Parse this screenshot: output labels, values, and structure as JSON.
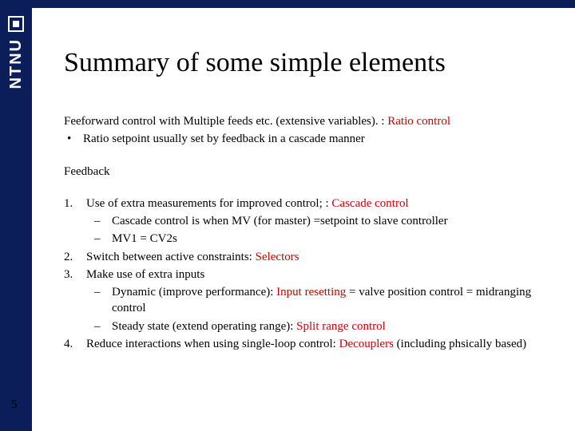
{
  "brand": {
    "name": "NTNU"
  },
  "slide": {
    "title": "Summary of some simple elements",
    "page_number": "5"
  },
  "feedforward": {
    "heading_pre": "Feeforward control with Multiple feeds etc. (extensive variables). : ",
    "heading_red": "Ratio control",
    "bullet": "Ratio setpoint usually set by feedback in a cascade manner"
  },
  "feedback": {
    "heading": "Feedback",
    "items": [
      {
        "num": "1.",
        "text_pre": "Use of extra measurements for improved control; : ",
        "text_red": "Cascade control",
        "subs": [
          {
            "dash": "–",
            "text": "Cascade control is when MV (for master) =setpoint  to slave controller"
          },
          {
            "dash": "–",
            "text": "MV1 = CV2s"
          }
        ]
      },
      {
        "num": "2.",
        "text_pre": "Switch between active constraints: ",
        "text_red": "Selectors",
        "subs": []
      },
      {
        "num": "3.",
        "text_pre": "Make use of extra inputs",
        "text_red": "",
        "subs": [
          {
            "dash": "–",
            "pre": "Dynamic (improve performance): ",
            "red": "Input resetting",
            "post": "  = valve position control = midranging control"
          },
          {
            "dash": "–",
            "pre": "Steady state (extend operating range): ",
            "red": "Split range control",
            "post": ""
          }
        ]
      },
      {
        "num": "4.",
        "text_pre": "Reduce interactions when using single-loop control: ",
        "text_red": "Decouplers",
        "text_post": " (including phsically based)",
        "subs": []
      }
    ]
  }
}
